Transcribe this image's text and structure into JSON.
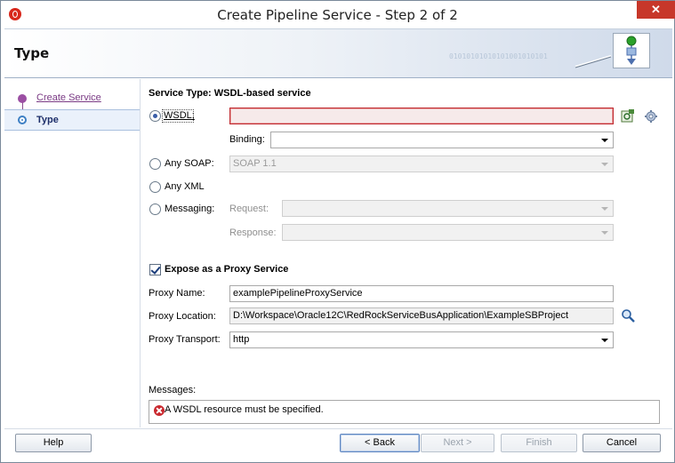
{
  "window": {
    "title": "Create Pipeline Service - Step 2 of 2",
    "close_glyph": "✕"
  },
  "header": {
    "title": "Type",
    "decoration": "01010101010101001010101"
  },
  "nav": {
    "items": [
      {
        "label": "Create Service",
        "state": "visited"
      },
      {
        "label": "Type",
        "state": "current"
      }
    ]
  },
  "form": {
    "section_title": "Service Type: WSDL-based service",
    "wsdl": {
      "label": "WSDL:",
      "value": "",
      "selected": true
    },
    "binding": {
      "label": "Binding:",
      "value": ""
    },
    "any_soap": {
      "label": "Any SOAP:",
      "value": "SOAP 1.1",
      "selected": false
    },
    "any_xml": {
      "label": "Any XML",
      "selected": false
    },
    "messaging": {
      "label": "Messaging:",
      "selected": false
    },
    "request": {
      "label": "Request:",
      "value": ""
    },
    "response": {
      "label": "Response:",
      "value": ""
    },
    "expose_proxy": {
      "label": "Expose as a Proxy Service",
      "checked": true
    },
    "proxy_name": {
      "label": "Proxy Name:",
      "value": "examplePipelineProxyService"
    },
    "proxy_location": {
      "label": "Proxy Location:",
      "value": "D:\\Workspace\\Oracle12C\\RedRockServiceBusApplication\\ExampleSBProject"
    },
    "proxy_transport": {
      "label": "Proxy Transport:",
      "value": "http"
    },
    "messages_label": "Messages:",
    "messages": [
      {
        "type": "error",
        "text": "A WSDL resource must be specified."
      }
    ]
  },
  "buttons": {
    "help": "Help",
    "back": "< Back",
    "next": "Next >",
    "finish": "Finish",
    "cancel": "Cancel"
  },
  "colors": {
    "error_border": "#c0282e",
    "nav_visited": "#7a3a84",
    "nav_current": "#1e2f6a",
    "close_button": "#c7372a"
  }
}
